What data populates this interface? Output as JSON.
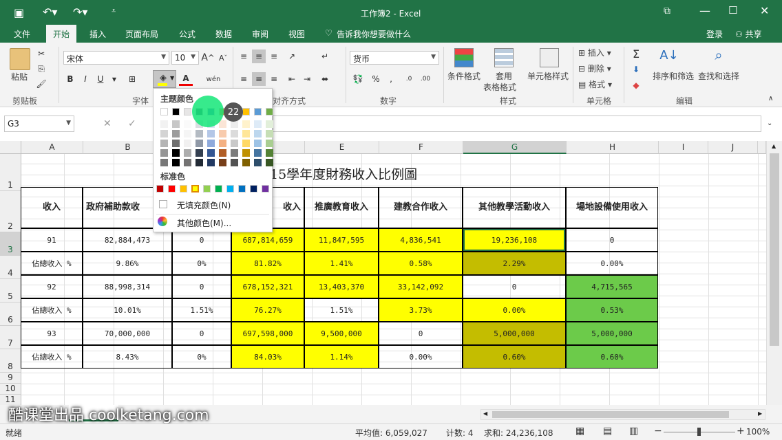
{
  "titlebar": {
    "title": "工作簿2 - Excel"
  },
  "menu": {
    "file": "文件",
    "home": "开始",
    "insert": "插入",
    "layout": "页面布局",
    "formulas": "公式",
    "data": "数据",
    "review": "审阅",
    "view": "视图",
    "tell_me": "告诉我你想要做什么",
    "login": "登录",
    "share": "共享"
  },
  "ribbon": {
    "paste": "粘贴",
    "clipboard": "剪贴板",
    "font_name": "宋体",
    "font_size": "10",
    "font_group": "字体",
    "align_group": "对齐方式",
    "number_format": "货币",
    "number_group": "数字",
    "cond_format": "条件格式",
    "table_format_1": "套用",
    "table_format_2": "表格格式",
    "cell_style": "单元格样式",
    "style_group": "样式",
    "insert": "插入",
    "delete": "删除",
    "format": "格式",
    "cells_group": "单元格",
    "sort_filter": "排序和筛选",
    "find_select": "查找和选择",
    "edit_group": "编辑",
    "bold": "B",
    "italic": "I",
    "underline": "U"
  },
  "formula_bar": {
    "name_box": "G3",
    "formula": ""
  },
  "columns": [
    "A",
    "B",
    "C",
    "D",
    "E",
    "F",
    "G",
    "H",
    "I",
    "J"
  ],
  "rows": [
    "1",
    "2",
    "3",
    "4",
    "5",
    "6",
    "7",
    "8",
    "9",
    "10",
    "11"
  ],
  "sheet": {
    "title_partial": "15學年度財務收入比例圖",
    "headers": [
      "收入",
      "政府補助款收",
      "",
      "收入",
      "推廣教育收入",
      "建教合作收入",
      "其他教學活動收入",
      "場地設備使用收入"
    ],
    "data": [
      [
        "91",
        "82,884,473",
        "0",
        "687,814,659",
        "11,847,595",
        "4,836,541",
        "19,236,108",
        "0"
      ],
      [
        "佔總收入 %",
        "9.86%",
        "0%",
        "81.82%",
        "1.41%",
        "0.58%",
        "2.29%",
        "0.00%"
      ],
      [
        "92",
        "88,998,314",
        "0",
        "678,152,321",
        "13,403,370",
        "33,142,092",
        "0",
        "4,715,565"
      ],
      [
        "佔總收入 %",
        "10.01%",
        "1.51%",
        "76.27%",
        "1.51%",
        "3.73%",
        "0.00%",
        "0.53%"
      ],
      [
        "93",
        "70,000,000",
        "0",
        "697,598,000",
        "9,500,000",
        "0",
        "5,000,000",
        "5,000,000"
      ],
      [
        "佔總收入 %",
        "8.43%",
        "0%",
        "84.03%",
        "1.14%",
        "0.00%",
        "0.60%",
        "0.60%"
      ]
    ]
  },
  "color_popup": {
    "theme_label": "主题颜色",
    "standard_label": "标准色",
    "no_fill": "无填充颜色(N)",
    "more_colors": "其他颜色(M)...",
    "badge": "22",
    "theme_top": [
      "#ffffff",
      "#000000",
      "#e7e6e6",
      "#44546a",
      "#4472c4",
      "#ed7d31",
      "#a5a5a5",
      "#ffc000",
      "#5b9bd5",
      "#70ad47"
    ],
    "standard": [
      "#c00000",
      "#ff0000",
      "#ffc000",
      "#ffff00",
      "#92d050",
      "#00b050",
      "#00b0f0",
      "#0070c0",
      "#002060",
      "#7030a0"
    ]
  },
  "status": {
    "ready": "就绪",
    "average": "平均值: 6,059,027",
    "count": "计数: 4",
    "sum": "求和: 24,236,108",
    "zoom": "100%"
  },
  "watermark": "酷课堂出品 coolketang.com"
}
